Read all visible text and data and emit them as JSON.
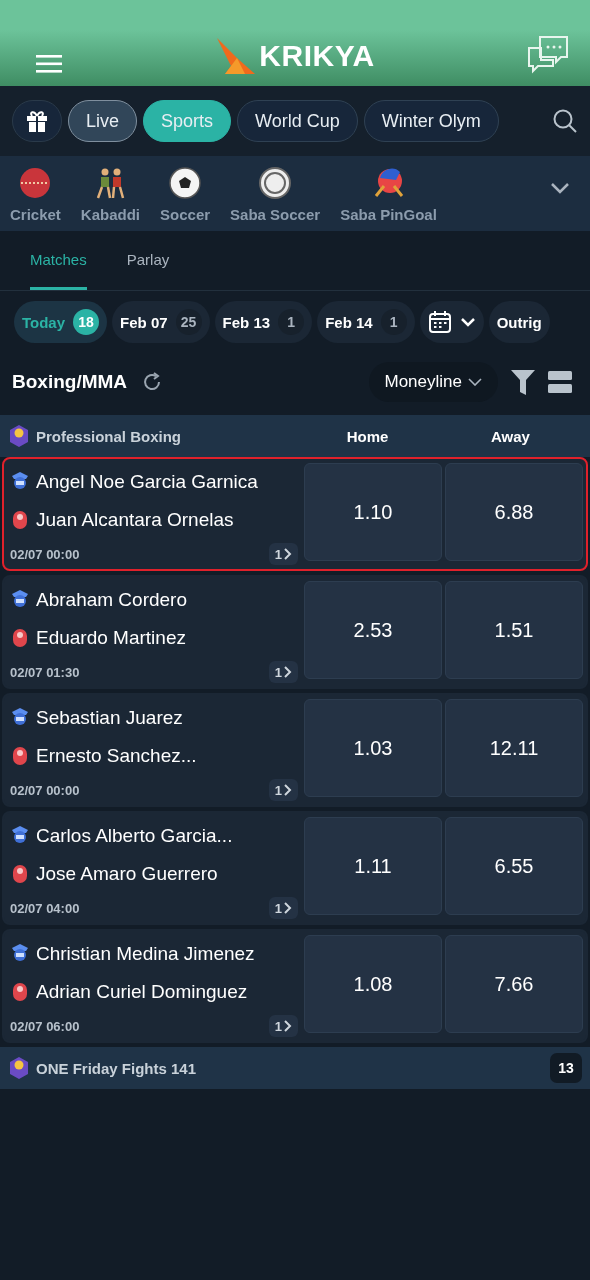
{
  "header": {
    "logo": "KRIKYA"
  },
  "nav_tabs": [
    {
      "label": "Live",
      "selected": false
    },
    {
      "label": "Sports",
      "selected": true
    },
    {
      "label": "World Cup",
      "selected": false
    },
    {
      "label": "Winter Olym",
      "selected": false
    }
  ],
  "sports": [
    {
      "label": "Cricket",
      "kind": "cricket"
    },
    {
      "label": "Kabaddi",
      "kind": "kabaddi"
    },
    {
      "label": "Soccer",
      "kind": "soccer"
    },
    {
      "label": "Saba Soccer",
      "kind": "saba"
    },
    {
      "label": "Saba PinGoal",
      "kind": "pingoal"
    }
  ],
  "sub_tabs": [
    {
      "label": "Matches",
      "selected": true
    },
    {
      "label": "Parlay",
      "selected": false
    }
  ],
  "dates": [
    {
      "label": "Today",
      "count": "18",
      "selected": true
    },
    {
      "label": "Feb 07",
      "count": "25",
      "selected": false
    },
    {
      "label": "Feb 13",
      "count": "1",
      "selected": false
    },
    {
      "label": "Feb 14",
      "count": "1",
      "selected": false
    }
  ],
  "outright": "Outrig",
  "section": {
    "title": "Boxing/MMA",
    "market": "Moneyline"
  },
  "league": {
    "name": "Professional Boxing",
    "columns": [
      "Home",
      "Away"
    ]
  },
  "matches": [
    {
      "home": "Angel Noe Garcia Garnica",
      "away": "Juan Alcantara Ornelas",
      "time": "02/07 00:00",
      "more": "1",
      "odds": [
        "1.10",
        "6.88"
      ],
      "highlighted": true
    },
    {
      "home": "Abraham Cordero",
      "away": "Eduardo Martinez",
      "time": "02/07 01:30",
      "more": "1",
      "odds": [
        "2.53",
        "1.51"
      ],
      "highlighted": false
    },
    {
      "home": "Sebastian Juarez",
      "away": "Ernesto Sanchez...",
      "time": "02/07 00:00",
      "more": "1",
      "odds": [
        "1.03",
        "12.11"
      ],
      "highlighted": false
    },
    {
      "home": "Carlos Alberto Garcia...",
      "away": "Jose Amaro Guerrero",
      "time": "02/07 04:00",
      "more": "1",
      "odds": [
        "1.11",
        "6.55"
      ],
      "highlighted": false
    },
    {
      "home": "Christian Medina Jimenez",
      "away": "Adrian Curiel Dominguez",
      "time": "02/07 06:00",
      "more": "1",
      "odds": [
        "1.08",
        "7.66"
      ],
      "highlighted": false
    }
  ],
  "other_leagues": [
    {
      "name": "ONE Friday Fights 141",
      "count": "13"
    }
  ]
}
